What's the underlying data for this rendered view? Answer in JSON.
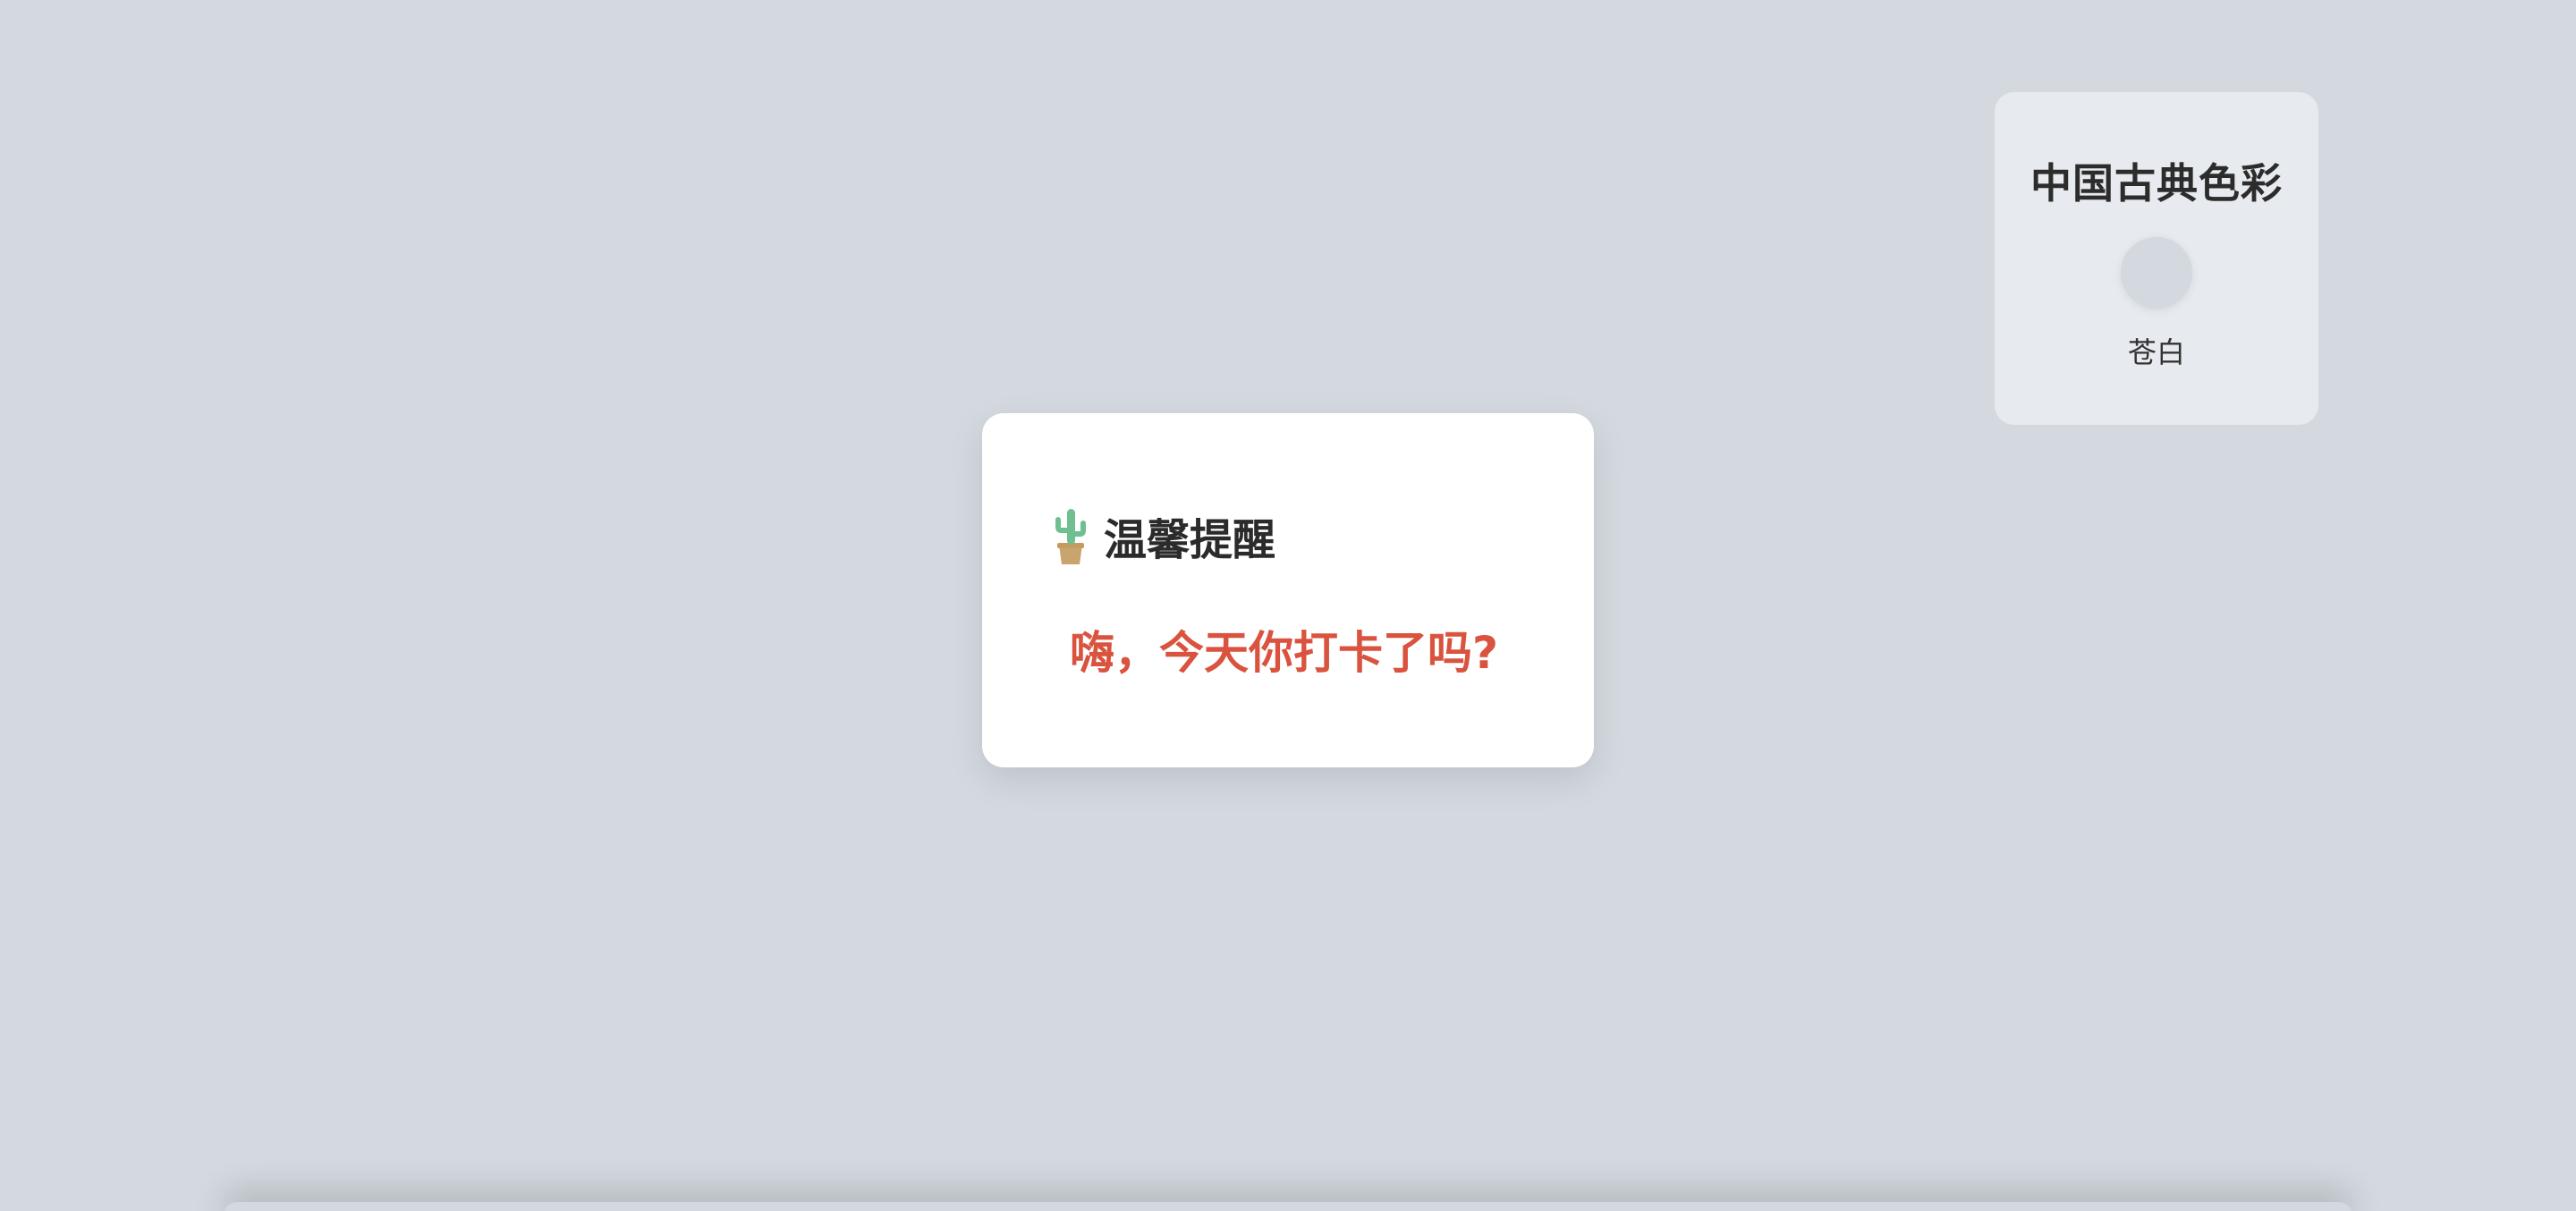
{
  "colors": {
    "background": "#d3d9df",
    "swatch": "#d3d9df",
    "message": "#d9533f"
  },
  "color_card": {
    "title": "中国古典色彩",
    "color_name": "苍白"
  },
  "dialog": {
    "icon": "cactus-icon",
    "title": "温馨提醒",
    "message": "嗨，今天你打卡了吗?"
  }
}
